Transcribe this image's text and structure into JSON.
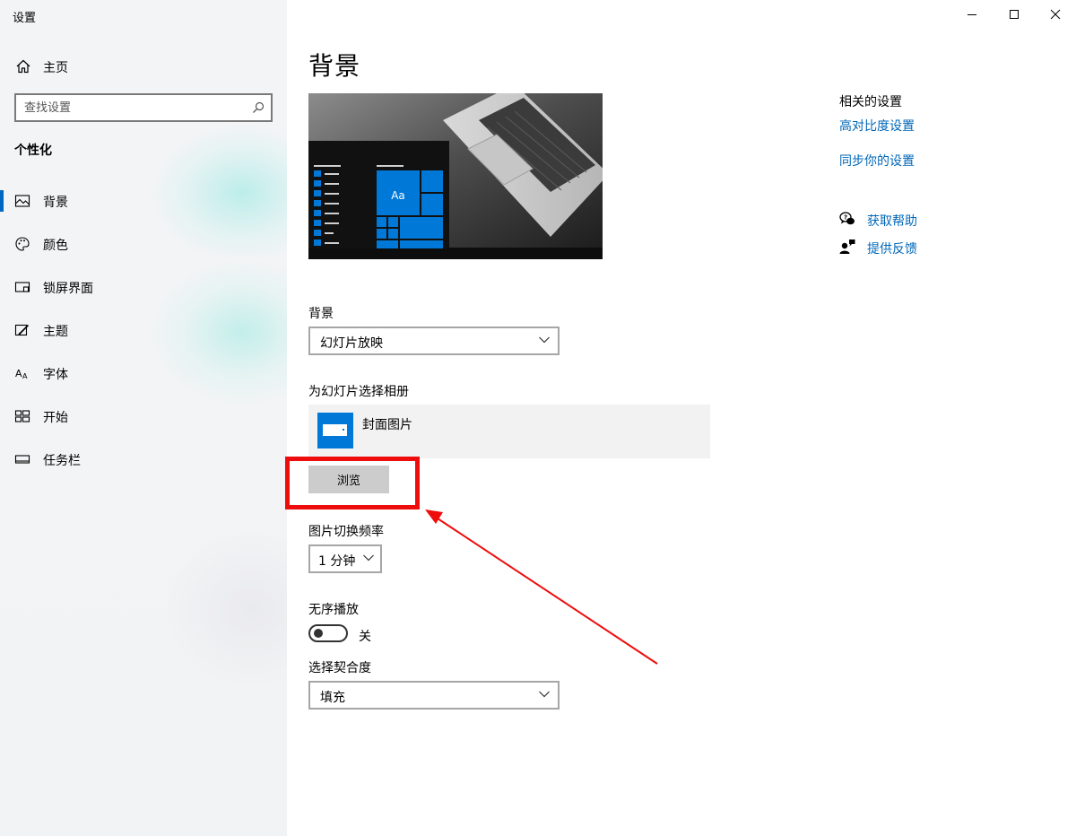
{
  "window": {
    "title": "设置",
    "minimize_icon": "minimize-icon",
    "maximize_icon": "maximize-icon",
    "close_icon": "close-icon"
  },
  "sidebar": {
    "home_label": "主页",
    "search_placeholder": "查找设置",
    "section_title": "个性化",
    "items": [
      {
        "label": "背景",
        "icon": "picture-icon",
        "active": true
      },
      {
        "label": "颜色",
        "icon": "palette-icon"
      },
      {
        "label": "锁屏界面",
        "icon": "lockscreen-icon"
      },
      {
        "label": "主题",
        "icon": "theme-brush-icon"
      },
      {
        "label": "字体",
        "icon": "font-icon"
      },
      {
        "label": "开始",
        "icon": "start-icon"
      },
      {
        "label": "任务栏",
        "icon": "taskbar-icon"
      }
    ]
  },
  "main": {
    "title": "背景",
    "preview": {
      "tile_label": "Aa"
    },
    "background_label": "背景",
    "background_value": "幻灯片放映",
    "album_label": "为幻灯片选择相册",
    "album_name": "封面图片",
    "browse_label": "浏览",
    "interval_label": "图片切换频率",
    "interval_value": "1 分钟",
    "shuffle_label": "无序播放",
    "shuffle_state": "关",
    "fit_label": "选择契合度",
    "fit_value": "填充"
  },
  "related": {
    "title": "相关的设置",
    "links": [
      "高对比度设置",
      "同步你的设置"
    ],
    "help_label": "获取帮助",
    "feedback_label": "提供反馈"
  },
  "colors": {
    "accent": "#0067b8",
    "annotation": "#ee0d0d"
  }
}
